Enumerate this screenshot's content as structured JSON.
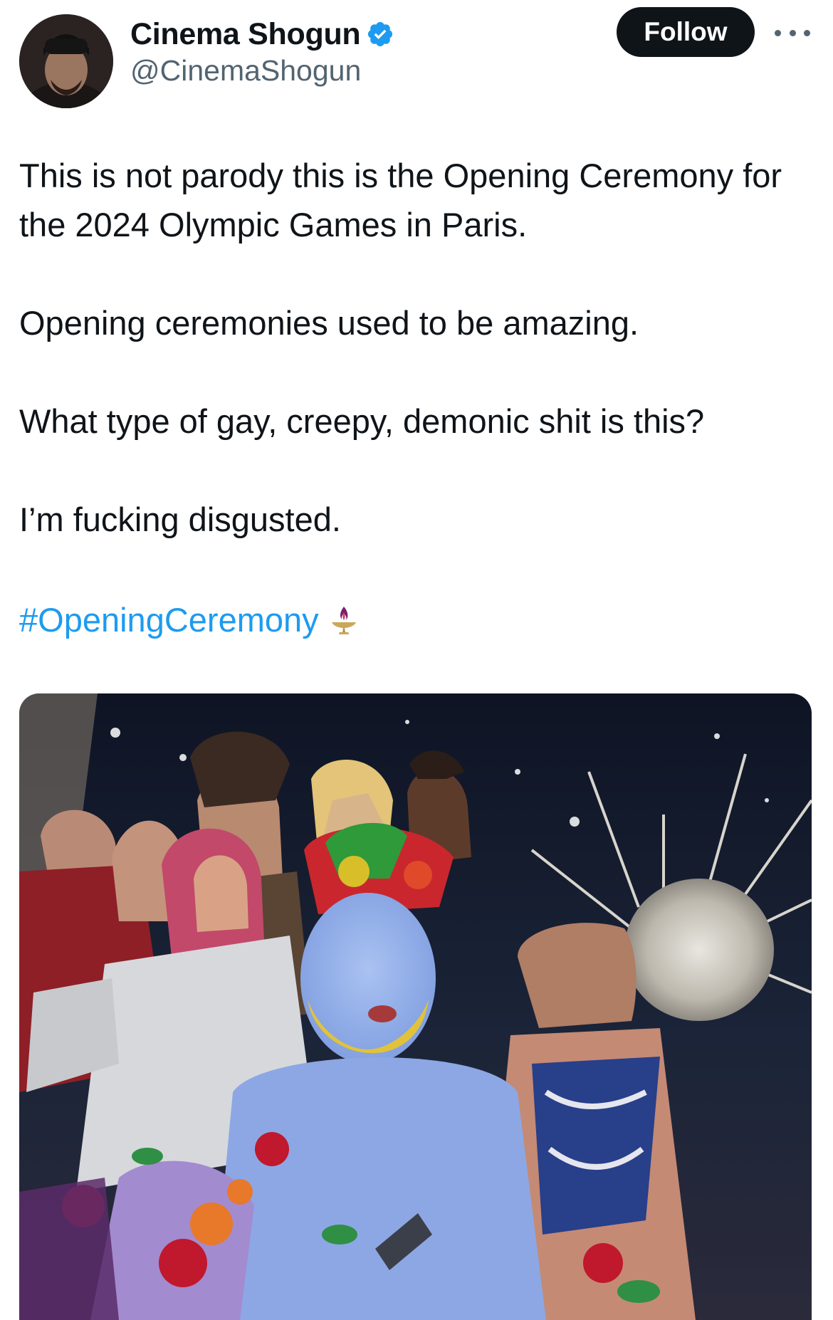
{
  "author": {
    "display_name": "Cinema Shogun",
    "handle": "@CinemaShogun",
    "verified": true,
    "verified_color": "#1d9bf0"
  },
  "actions": {
    "follow_label": "Follow",
    "more_icon": "more-horizontal-icon"
  },
  "tweet": {
    "paragraphs": [
      "This is not parody this is the Opening Ceremony for the 2024 Olympic Games in Paris.",
      "Opening ceremonies used to be amazing.",
      "What type of gay, creepy, demonic shit is this?",
      "I’m fucking disgusted."
    ],
    "hashtag": "#OpeningCeremony",
    "emoji": "olympic-torch-icon"
  },
  "media": {
    "type": "image",
    "icon": "photo"
  },
  "colors": {
    "text": "#0f1419",
    "secondary": "#536471",
    "link": "#1d9bf0",
    "follow_bg": "#0f1419"
  }
}
